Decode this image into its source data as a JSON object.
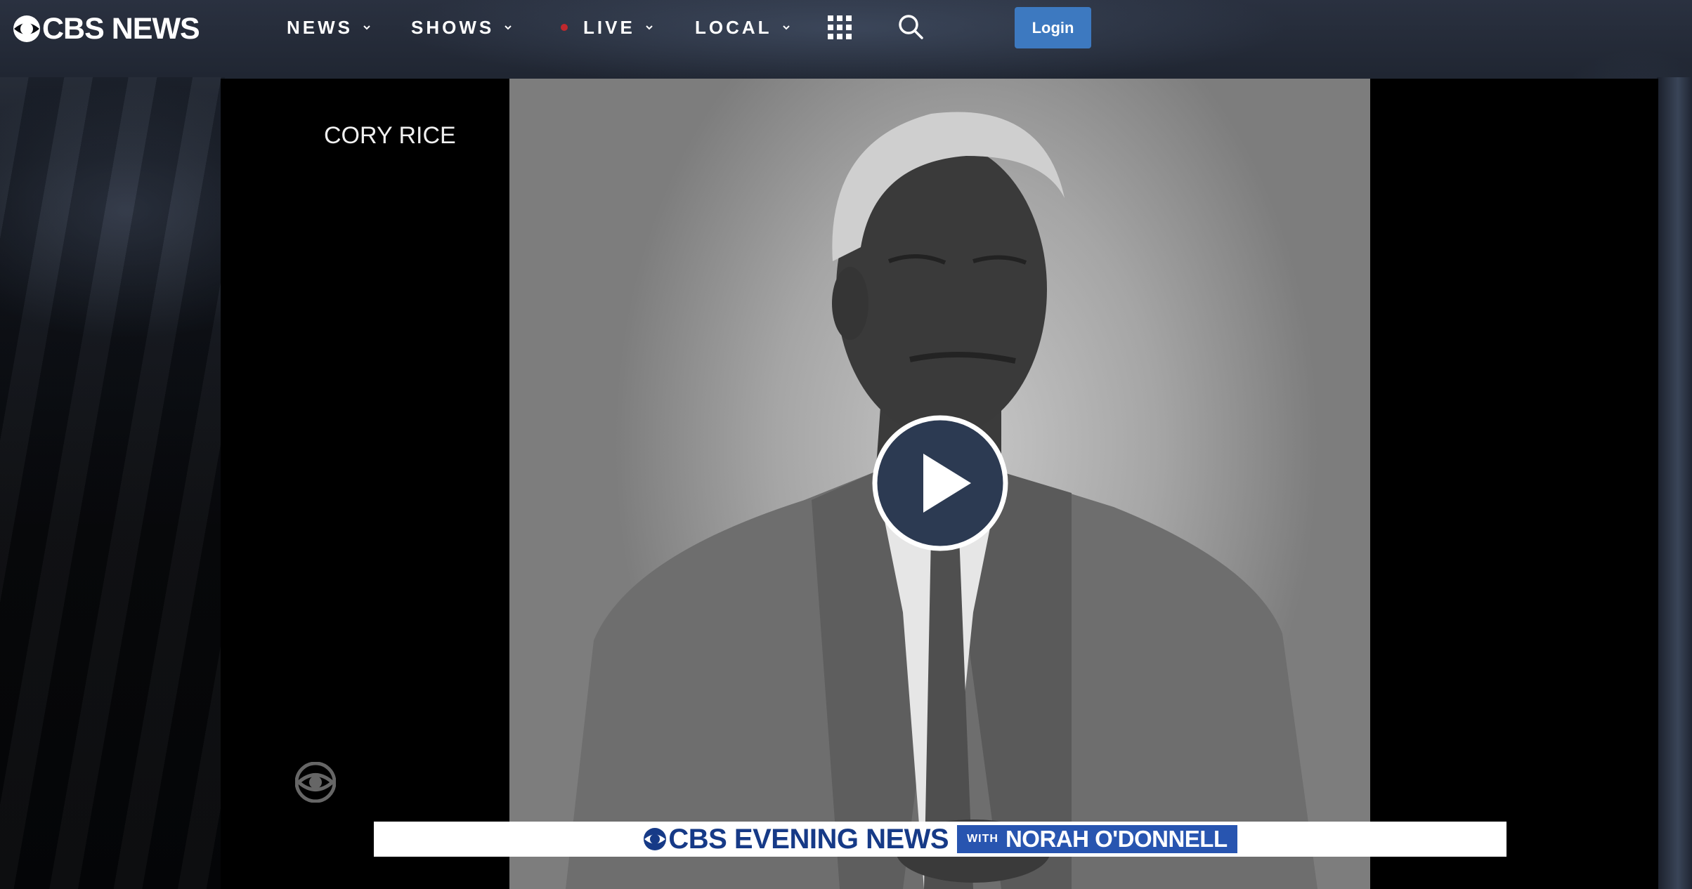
{
  "header": {
    "logo_text": "CBS NEWS",
    "nav": [
      {
        "label": "NEWS",
        "has_dropdown": true
      },
      {
        "label": "SHOWS",
        "has_dropdown": true
      },
      {
        "label": "LIVE",
        "has_dropdown": true,
        "live_indicator": true
      },
      {
        "label": "LOCAL",
        "has_dropdown": true
      }
    ],
    "icons": {
      "apps": "apps-grid-icon",
      "search": "search-icon"
    },
    "login_label": "Login"
  },
  "player": {
    "reporter_name": "CORY RICE",
    "play_icon": "play-icon",
    "lower_third": {
      "show_name": "CBS EVENING NEWS",
      "with_label": "WITH",
      "anchor": "NORAH O'DONNELL"
    }
  },
  "colors": {
    "login_button": "#3d79c0",
    "live_dot": "#c0282d",
    "play_button": "#2c3a52",
    "lower_third_text": "#163a87",
    "lower_third_box": "#2855b0"
  }
}
